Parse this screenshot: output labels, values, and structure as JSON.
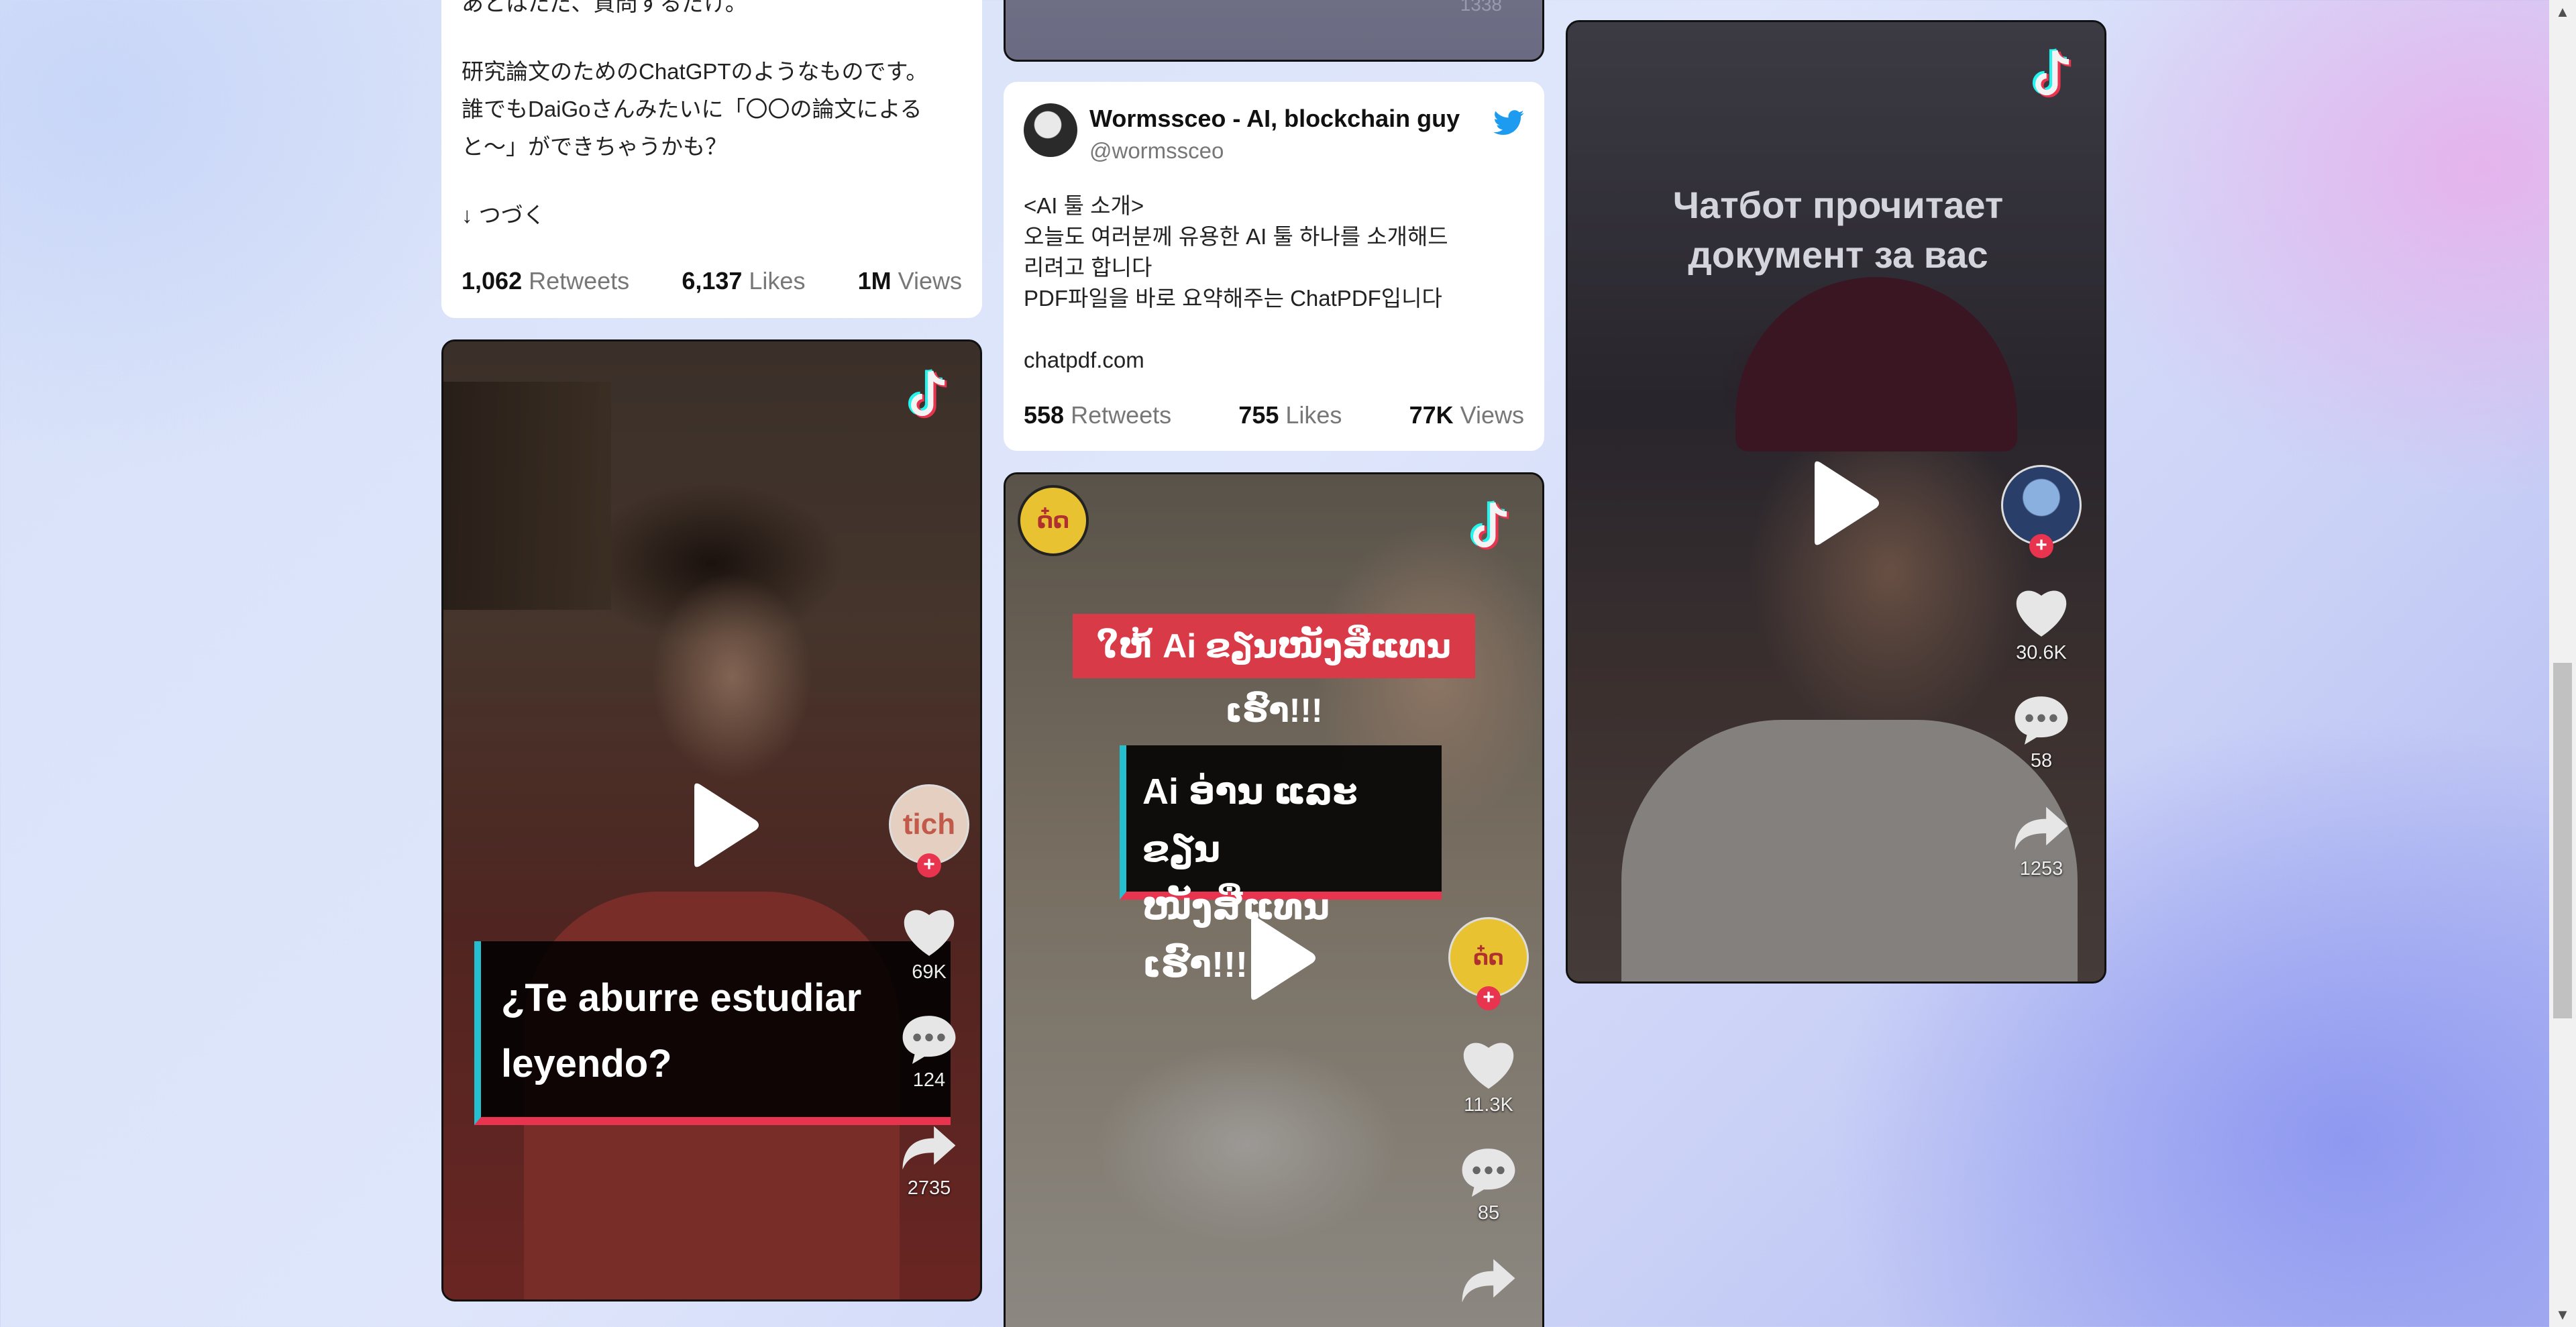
{
  "tweet_jp": {
    "text_lines": [
      "あとはただ、質問するだけ。",
      "",
      "研究論文のためのChatGPTのようなものです。",
      "誰でもDaiGoさんみたいに「〇〇の論文による",
      "と〜」ができちゃうかも？",
      "",
      "↓ つづく"
    ],
    "retweets": "1,062",
    "retweets_label": "Retweets",
    "likes": "6,137",
    "likes_label": "Likes",
    "views": "1M",
    "views_label": "Views"
  },
  "tweet_kr": {
    "author_name": "Wormssceo - AI, blockchain guy",
    "author_handle": "@wormssceo",
    "text_lines": [
      "<AI 툴 소개>",
      "오늘도 여러분께 유용한 AI 툴 하나를 소개해드",
      "리려고 합니다",
      "PDF파일을 바로 요약해주는 ChatPDF입니다",
      "",
      "chatpdf.com"
    ],
    "retweets": "558",
    "retweets_label": "Retweets",
    "likes": "755",
    "likes_label": "Likes",
    "views": "77K",
    "views_label": "Views"
  },
  "video_es": {
    "caption_line1": "¿Te aburre estudiar",
    "caption_line2": "leyendo?",
    "avatar_text": "tich",
    "likes": "69K",
    "comments": "124",
    "shares": "2735"
  },
  "video_lao": {
    "banner_text": "ໃຫ້ Ai ຂຽນໜັງສືແທນເຮົາ!!!",
    "caption_line1": "Ai ອ່ານ ແລະ ຂຽນ",
    "caption_line2": "ໜັງສືແທນເຮົາ!!!",
    "likes": "11.3K",
    "comments": "85"
  },
  "video_ru": {
    "caption_line1": "Чатбот прочитает",
    "caption_line2": "документ за вас",
    "likes": "30.6K",
    "comments": "58",
    "shares": "1253"
  },
  "top_card_partial_count": "1338",
  "colors": {
    "twitter_blue": "#1d9bf0",
    "tiktok_red": "#e8344e",
    "tiktok_cyan": "#25f4ee"
  }
}
